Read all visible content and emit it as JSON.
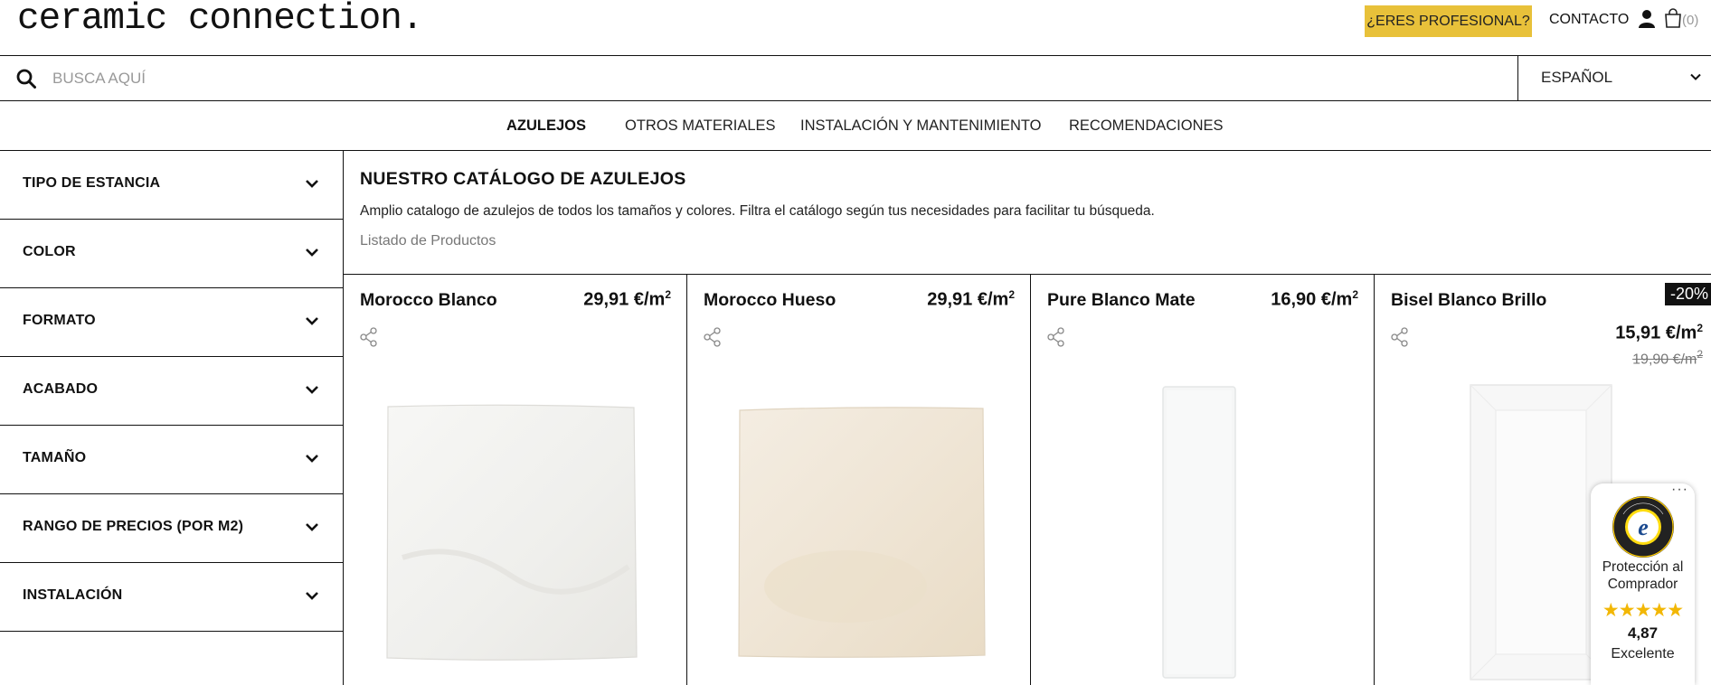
{
  "header": {
    "logo": "ceramic connection.",
    "pro_button": "¿ERES PROFESIONAL?",
    "contact": "CONTACTO",
    "cart_count": "(0)"
  },
  "search": {
    "placeholder": "BUSCA AQUÍ",
    "language": "ESPAÑOL"
  },
  "nav": {
    "items": [
      {
        "label": "AZULEJOS",
        "active": true
      },
      {
        "label": "OTROS MATERIALES",
        "active": false
      },
      {
        "label": "INSTALACIÓN Y MANTENIMIENTO",
        "active": false
      },
      {
        "label": "RECOMENDACIONES",
        "active": false
      }
    ]
  },
  "filters": [
    {
      "label": "TIPO DE ESTANCIA"
    },
    {
      "label": "COLOR"
    },
    {
      "label": "FORMATO"
    },
    {
      "label": "ACABADO"
    },
    {
      "label": "TAMAÑO"
    },
    {
      "label": "RANGO DE PRECIOS (POR M2)"
    },
    {
      "label": "INSTALACIÓN"
    }
  ],
  "catalog": {
    "title": "NUESTRO CATÁLOGO DE AZULEJOS",
    "description": "Amplio catalogo de azulejos de todos los tamaños y colores. Filtra el catálogo según tus necesidades para facilitar tu búsqueda.",
    "subtitle": "Listado de Productos"
  },
  "products": [
    {
      "name": "Morocco Blanco",
      "price": "29,91 €/m",
      "price_sup": "2",
      "tile_color": "#f3f2ef"
    },
    {
      "name": "Morocco Hueso",
      "price": "29,91 €/m",
      "price_sup": "2",
      "tile_color": "#f1e9dc"
    },
    {
      "name": "Pure Blanco Mate",
      "price": "16,90 €/m",
      "price_sup": "2",
      "tile_color": "#f4f5f5"
    },
    {
      "name": "Bisel Blanco Brillo",
      "price": "15,91 €/m",
      "price_sup": "2",
      "old_price": "19,90 €/m",
      "old_sup": "2",
      "badge": "-20%",
      "tile_color": "#f7f7f7"
    }
  ],
  "trusted_shops": {
    "protection": "Protección al Comprador",
    "stars": "★★★★★",
    "score": "4,87",
    "label": "Excelente",
    "dots": "···"
  },
  "colors": {
    "accent": "#e8c13a",
    "star": "#f2b705"
  }
}
